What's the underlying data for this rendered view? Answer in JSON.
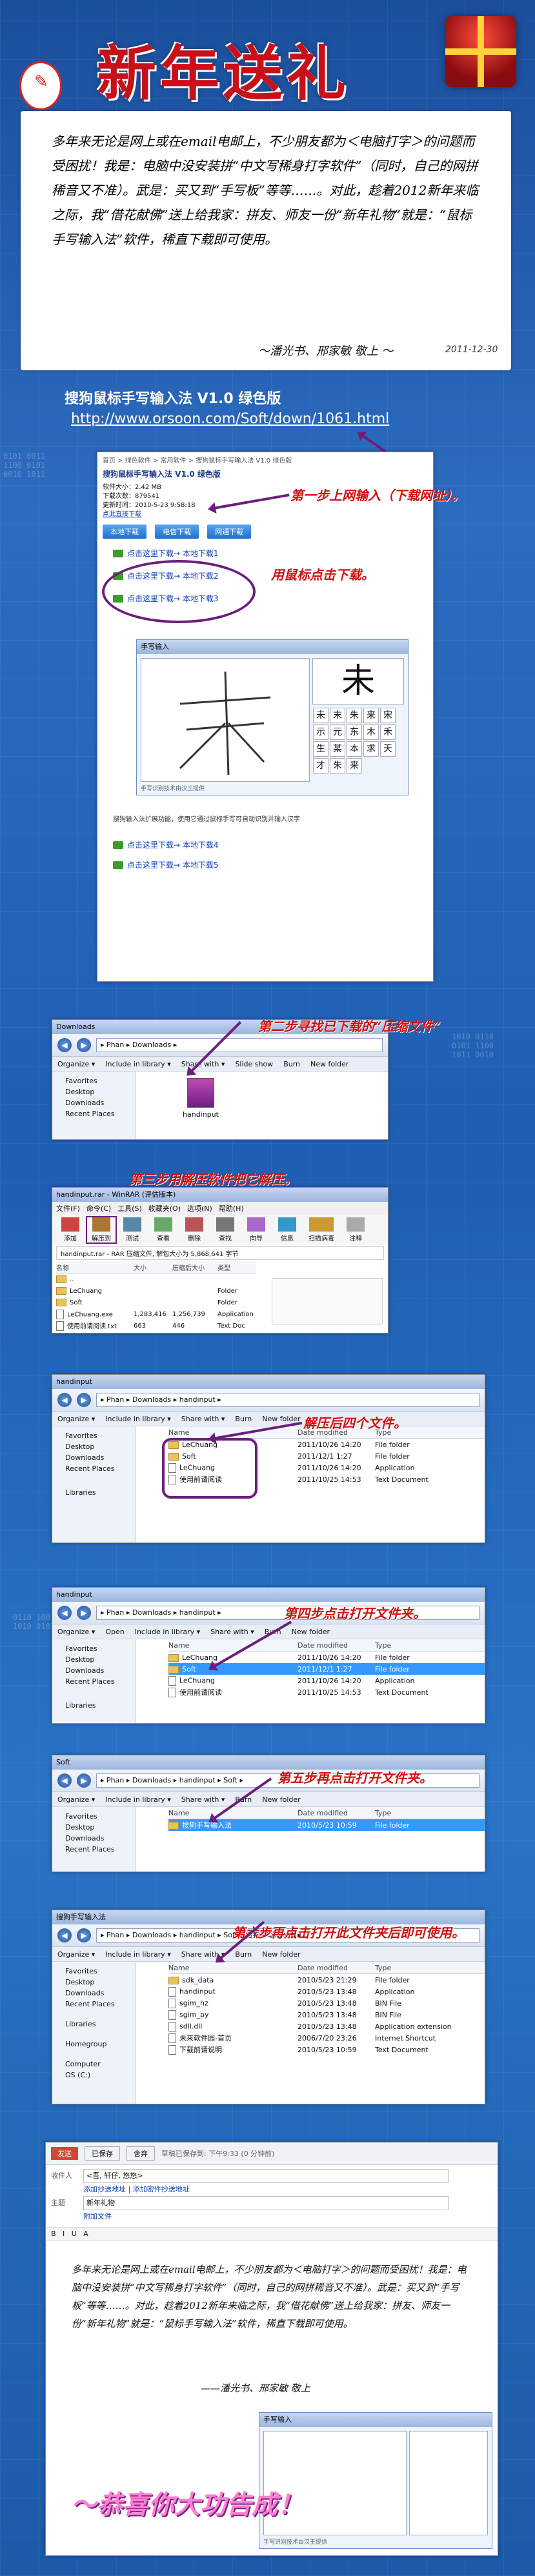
{
  "header": {
    "title": "新年送礼"
  },
  "intro": {
    "paragraph": "多年来无论是网上或在email电邮上，不少朋友都为＜电脑打字＞的问题而受困扰！我是：电脑中没安装拼“中文写稀身打字软件”（同时，自己的网拼稀音又不准）。武是：买又到“手写板”等等……。对此，趁着2012新年来临之际，我“借花献佛”送上给我家：拼友、师友一份“新年礼物”就是：“鼠标手写输入法”软件，稀直下载即可使用。",
    "signoff": "～潘光书、邢家敏 敬上 ～",
    "date": "2011-12-30"
  },
  "section": {
    "title": "搜狗鼠标手写输入法 V1.0 绿色版",
    "url": "http://www.orsoon.com/Soft/down/1061.html"
  },
  "download_page": {
    "breadcrumb": "首页 > 绿色软件 > 常用软件 > 搜狗鼠标手写输入法 V1.0 绿色版",
    "heading": "搜狗鼠标手写输入法 V1.0 绿色版",
    "info": [
      "软件大小：2.42 MB",
      "下载次数：879541",
      "更新时间：2010-5-23 9:58:18",
      "点此直接下载"
    ],
    "buttons": [
      "本地下载",
      "电信下载",
      "网通下载"
    ],
    "links": [
      "点击这里下载→ 本地下载1",
      "点击这里下载→ 本地下载2",
      "点击这里下载→ 本地下载3"
    ],
    "note": "搜狗输入法扩展功能，使用它通过鼠标手写可自动识别并输入汉字",
    "bottom_links": [
      "点击这里下载→ 本地下载4",
      "点击这里下载→ 本地下载5"
    ],
    "hw_title": "手写输入",
    "hw_footer": "手写识别技术由汉王提供",
    "big_char": "未",
    "candidates": [
      "未",
      "末",
      "朱",
      "来",
      "宋",
      "示",
      "元",
      "东",
      "木",
      "禾",
      "生",
      "某",
      "本",
      "求",
      "天",
      "才",
      "朱",
      "来"
    ]
  },
  "steps": [
    "第一步上网输入（下载网址）。",
    "用鼠标点击下载。",
    "第二步寻找已下载的“压缩文件”",
    "第三步用解压软件把它解压。",
    "解压后四个文件。",
    "第四步点击打开文件夹。",
    "第五步再点击打开文件夹。",
    "第六步再点击打开此文件夹后即可使用。"
  ],
  "explorer_downloads": {
    "title": "Downloads",
    "address": "▸ Phan ▸ Downloads ▸",
    "commands": [
      "Organize ▾",
      "Include in library ▾",
      "Share with ▾",
      "Slide show",
      "Burn",
      "New folder"
    ],
    "pane": [
      "Favorites",
      "Desktop",
      "Downloads",
      "Recent Places"
    ],
    "file": "handinput"
  },
  "rar": {
    "title": "handinput.rar - WinRAR (评估版本)",
    "menu": [
      "文件(F)",
      "命令(C)",
      "工具(S)",
      "收藏夹(O)",
      "选项(N)",
      "帮助(H)"
    ],
    "tools": [
      "添加",
      "解压到",
      "测试",
      "查看",
      "删除",
      "查找",
      "向导",
      "信息",
      "扫描病毒",
      "注释"
    ],
    "path": "handinput.rar - RAR 压缩文件, 解包大小为 5,868,641 字节",
    "headers": [
      "名称",
      "大小",
      "压缩后大小",
      "类型"
    ],
    "rows": [
      [
        "..",
        "",
        "",
        ""
      ],
      [
        "LeChuang",
        "",
        "",
        "Folder"
      ],
      [
        "Soft",
        "",
        "",
        "Folder"
      ],
      [
        "LeChuang.exe",
        "1,283,416",
        "1,256,739",
        "Application"
      ],
      [
        "使用前请阅读.txt",
        "663",
        "446",
        "Text Doc"
      ]
    ]
  },
  "explorer_handinput": {
    "title": "handinput",
    "address": "▸ Phan ▸ Downloads ▸ handinput ▸",
    "commands": [
      "Organize ▾",
      "Include in library ▾",
      "Share with ▾",
      "Burn",
      "New folder"
    ],
    "pane": [
      "Favorites",
      "Desktop",
      "Downloads",
      "Recent Places",
      "Libraries"
    ],
    "headers": [
      "Name",
      "Date modified",
      "Type"
    ],
    "rows": [
      [
        "LeChuang",
        "2011/10/26 14:20",
        "File folder"
      ],
      [
        "Soft",
        "2011/12/1 1:27",
        "File folder"
      ],
      [
        "LeChuang",
        "2011/10/26 14:20",
        "Application"
      ],
      [
        "使用前请阅读",
        "2011/10/25 14:53",
        "Text Document"
      ]
    ]
  },
  "explorer_handinput2": {
    "title": "handinput",
    "address": "▸ Phan ▸ Downloads ▸ handinput ▸",
    "commands": [
      "Organize ▾",
      "Open",
      "Include in library ▾",
      "Share with ▾",
      "Burn",
      "New folder"
    ],
    "pane": [
      "Favorites",
      "Desktop",
      "Downloads",
      "Recent Places",
      "Libraries"
    ],
    "headers": [
      "Name",
      "Date modified",
      "Type"
    ],
    "rows": [
      [
        "LeChuang",
        "2011/10/26 14:20",
        "File folder"
      ],
      [
        "Soft",
        "2011/12/1 1:27",
        "File folder"
      ],
      [
        "LeChuang",
        "2011/10/26 14:20",
        "Application"
      ],
      [
        "使用前请阅读",
        "2011/10/25 14:53",
        "Text Document"
      ]
    ]
  },
  "explorer_soft": {
    "title": "Soft",
    "address": "▸ Phan ▸ Downloads ▸ handinput ▸ Soft ▸",
    "commands": [
      "Organize ▾",
      "Include in library ▾",
      "Share with ▾",
      "Burn",
      "New folder"
    ],
    "pane": [
      "Favorites",
      "Desktop",
      "Downloads",
      "Recent Places"
    ],
    "headers": [
      "Name",
      "Date modified",
      "Type"
    ],
    "rows": [
      [
        "搜狗手写输入法",
        "2010/5/23 10:59",
        "File folder"
      ]
    ]
  },
  "explorer_sogou": {
    "title": "搜狗手写输入法",
    "address": "▸ Phan ▸ Downloads ▸ handinput ▸ Soft ▸ 搜狗手写输入法 ▸",
    "commands": [
      "Organize ▾",
      "Include in library ▾",
      "Share with ▾",
      "Burn",
      "New folder"
    ],
    "pane": [
      "Favorites",
      "Desktop",
      "Downloads",
      "Recent Places",
      "Libraries",
      "Homegroup",
      "Computer",
      "OS (C:)"
    ],
    "headers": [
      "Name",
      "Date modified",
      "Type"
    ],
    "rows": [
      [
        "sdk_data",
        "2010/5/23 21:29",
        "File folder"
      ],
      [
        "handinput",
        "2010/5/23 13:48",
        "Application"
      ],
      [
        "sgim_hz",
        "2010/5/23 13:48",
        "BIN File"
      ],
      [
        "sgim_py",
        "2010/5/23 13:48",
        "BIN File"
      ],
      [
        "sdll.dll",
        "2010/5/23 13:48",
        "Application extension"
      ],
      [
        "未来软件园-首页",
        "2006/7/20 23:26",
        "Internet Shortcut"
      ],
      [
        "下载前请说明",
        "2010/5/23 10:59",
        "Text Document"
      ]
    ]
  },
  "mail": {
    "send": "发送",
    "saved": "已保存",
    "discard": "舍弃",
    "draft_note": "草稿已保存到: 下午9:33 (0 分钟前)",
    "to_label": "收件人",
    "to_value": "<吾, 轩仔, 悠悠>",
    "cc_links": "添加抄送地址 | 添加密件抄送地址",
    "subject_label": "主题",
    "subject_value": "新年礼物",
    "attach": "附加文件",
    "body": "多年来无论是网上或在email电邮上，不少朋友都为＜电脑打字＞的问题而受困扰！我是：电脑中没安装拼“中文写稀身打字软件”（同时，自己的网拼稀音又不准）。武是：买又到“手写板”等等……。对此，趁着2012新年来临之际，我“借花献佛”送上给我家：拼友、师友一份“新年礼物”就是：“鼠标手写输入法”软件，稀直下载即可使用。",
    "body_sign": "——潘光书、邢家敏 敬上",
    "mini_hw_footer": "手写识别技术由汉王提供"
  },
  "congrats": "～恭喜你大功告成！"
}
